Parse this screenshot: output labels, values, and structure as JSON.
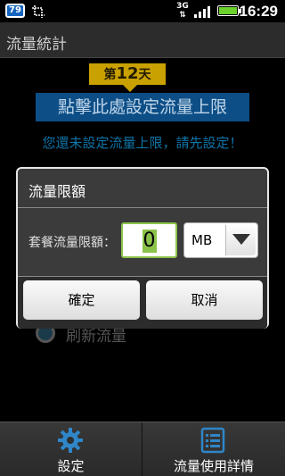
{
  "status_bar": {
    "notification_badge": "79",
    "network_type": "3G",
    "clock": "16:29"
  },
  "app": {
    "title": "流量統計"
  },
  "main": {
    "day_badge_prefix": "第",
    "day_badge_number": "12",
    "day_badge_suffix": "天",
    "set_limit_link": "點擊此處設定流量上限",
    "notice": "您還未設定流量上限，請先設定！",
    "refresh_label": "刷新流量"
  },
  "dialog": {
    "title": "流量限額",
    "quota_label": "套餐流量限額：",
    "quota_value": "0",
    "unit_value": "MB",
    "ok_label": "確定",
    "cancel_label": "取消"
  },
  "bottom_tabs": [
    {
      "label": "設定",
      "icon": "gear-icon"
    },
    {
      "label": "流量使用詳情",
      "icon": "list-icon"
    }
  ],
  "colors": {
    "accent_link_bg": "#0d4e86",
    "notice_text": "#0f74a8",
    "day_badge_bg": "#c9a100",
    "input_focus": "#8bc34a",
    "battery": "#6bd12b"
  }
}
